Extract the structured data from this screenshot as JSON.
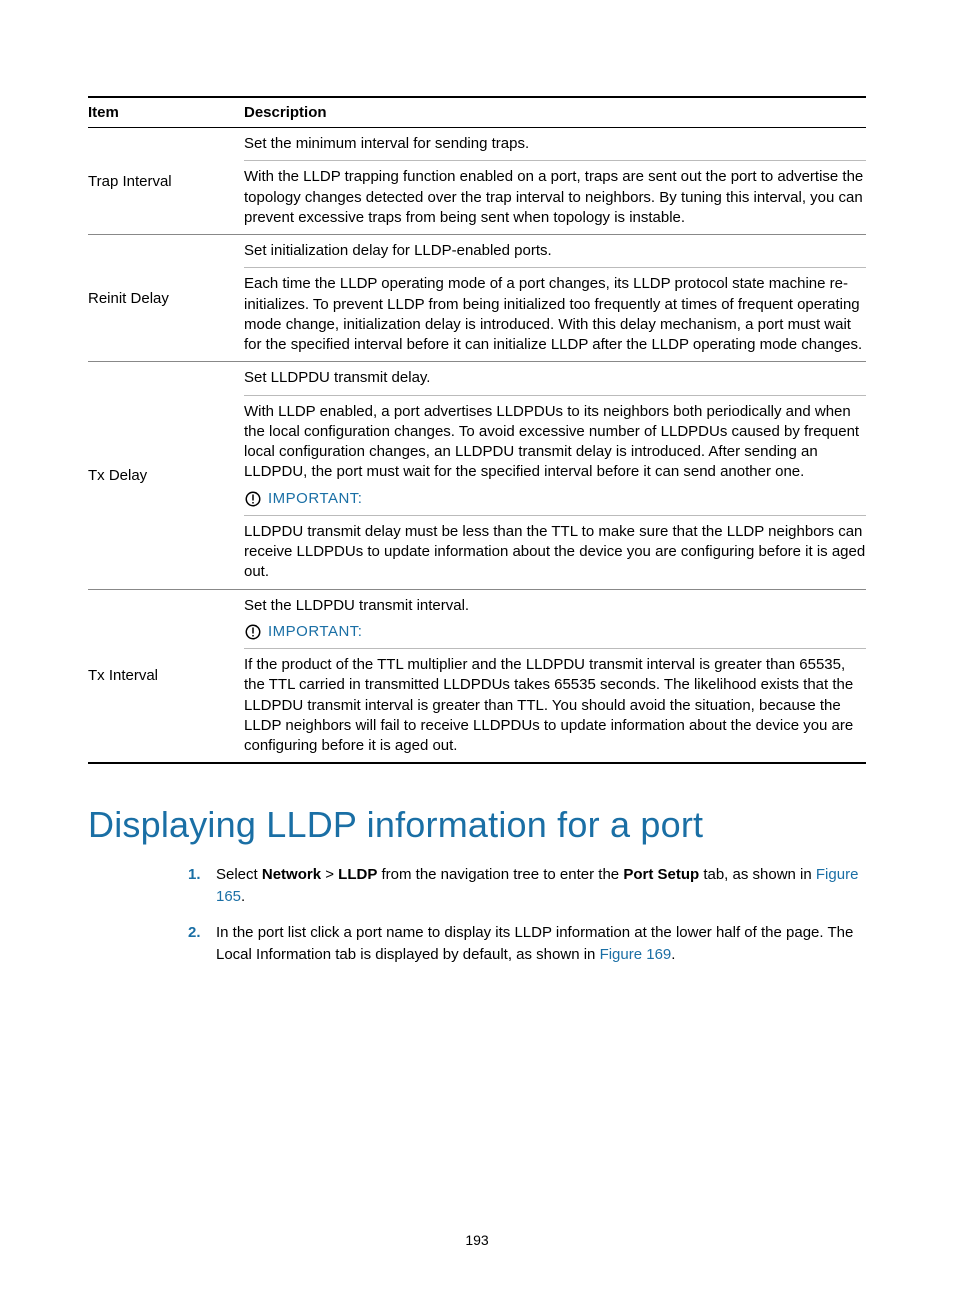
{
  "table": {
    "headers": {
      "item": "Item",
      "description": "Description"
    },
    "rows": [
      {
        "item": "Trap Interval",
        "blocks": [
          {
            "type": "text",
            "text": "Set the minimum interval for sending traps."
          },
          {
            "type": "text",
            "text": "With the LLDP trapping function enabled on a port, traps are sent out the port to advertise the topology changes detected over the trap interval to neighbors. By tuning this interval, you can prevent excessive traps from being sent when topology is instable."
          }
        ]
      },
      {
        "item": "Reinit Delay",
        "blocks": [
          {
            "type": "text",
            "text": "Set initialization delay for LLDP-enabled ports."
          },
          {
            "type": "text",
            "text": "Each time the LLDP operating mode of a port changes, its LLDP protocol state machine re-initializes. To prevent LLDP from being initialized too frequently at times of frequent operating mode change, initialization delay is introduced. With this delay mechanism, a port must wait for the specified interval before it can initialize LLDP after the LLDP operating mode changes."
          }
        ]
      },
      {
        "item": "Tx Delay",
        "blocks": [
          {
            "type": "text",
            "text": "Set LLDPDU transmit delay."
          },
          {
            "type": "text-with-important",
            "text": "With LLDP enabled, a port advertises LLDPDUs to its neighbors both periodically and when the local configuration changes. To avoid excessive number of LLDPDUs caused by frequent local configuration changes, an LLDPDU transmit delay is introduced. After sending an LLDPDU, the port must wait for the specified interval before it can send another one.",
            "important_label": "IMPORTANT:"
          },
          {
            "type": "text",
            "text": "LLDPDU transmit delay must be less than the TTL to make sure that the LLDP neighbors can receive LLDPDUs to update information about the device you are configuring before it is aged out."
          }
        ]
      },
      {
        "item": "Tx Interval",
        "blocks": [
          {
            "type": "text-with-important",
            "text": "Set the LLDPDU transmit interval.",
            "important_label": "IMPORTANT:"
          },
          {
            "type": "text",
            "text": "If the product of the TTL multiplier and the LLDPDU transmit interval is greater than 65535, the TTL carried in transmitted LLDPDUs takes 65535 seconds. The likelihood exists that the LLDPDU transmit interval is greater than TTL. You should avoid the situation, because the LLDP neighbors will fail to receive LLDPDUs to update information about the device you are configuring before it is aged out."
          }
        ]
      }
    ]
  },
  "section_heading": "Displaying LLDP information for a port",
  "steps": [
    {
      "parts": [
        {
          "t": "text",
          "v": "Select "
        },
        {
          "t": "bold",
          "v": "Network"
        },
        {
          "t": "text",
          "v": " > "
        },
        {
          "t": "bold",
          "v": "LLDP"
        },
        {
          "t": "text",
          "v": " from the navigation tree to enter the "
        },
        {
          "t": "bold",
          "v": "Port Setup"
        },
        {
          "t": "text",
          "v": " tab, as shown in "
        },
        {
          "t": "link",
          "v": "Figure 165"
        },
        {
          "t": "text",
          "v": "."
        }
      ]
    },
    {
      "parts": [
        {
          "t": "text",
          "v": "In the port list click a port name to display its LLDP information at the lower half of the page. The Local Information tab is displayed by default, as shown in "
        },
        {
          "t": "link",
          "v": "Figure 169"
        },
        {
          "t": "text",
          "v": "."
        }
      ]
    }
  ],
  "page_number": "193"
}
